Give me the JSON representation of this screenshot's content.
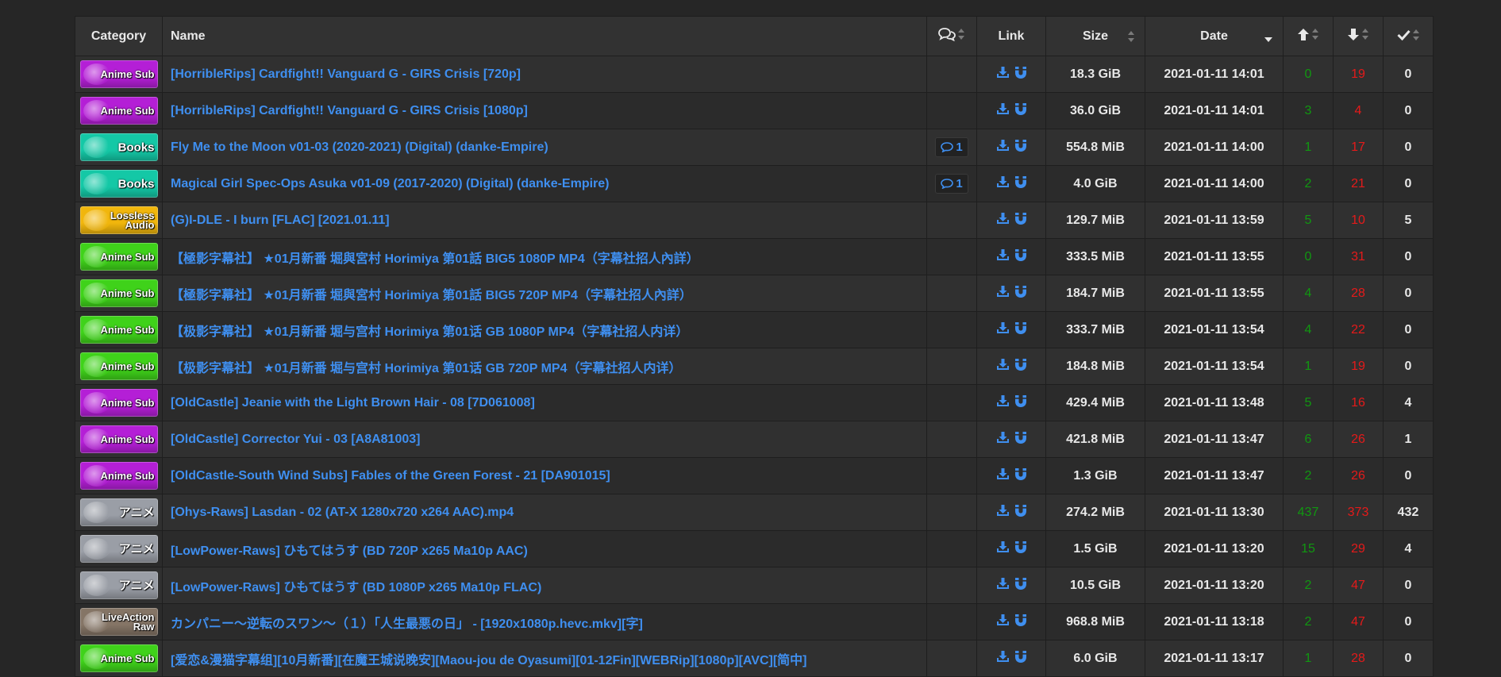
{
  "headers": {
    "category": "Category",
    "name": "Name",
    "comments_icon": "comments-icon",
    "link": "Link",
    "size": "Size",
    "date": "Date",
    "seeders_icon": "arrow-up-icon",
    "leechers_icon": "arrow-down-icon",
    "completed_icon": "check-icon"
  },
  "colors": {
    "link": "#3f8ff0",
    "seeders": "#109810",
    "leechers": "#e51a1a",
    "anime_sub_purple": "#b41fd6",
    "anime_sub_green": "#3fd21a",
    "books": "#14c8a6",
    "lossless_audio": "#f1b60c",
    "raw_anime": "#9a9ea6",
    "live_action_raw": "#857566"
  },
  "rows": [
    {
      "cat": "Anime Sub",
      "catColor": "#b41fd6",
      "name": "[HorribleRips] Cardfight!! Vanguard G - GIRS Crisis [720p]",
      "comments": "",
      "size": "18.3 GiB",
      "date": "2021-01-11 14:01",
      "seeders": "0",
      "leechers": "19",
      "completed": "0"
    },
    {
      "cat": "Anime Sub",
      "catColor": "#b41fd6",
      "name": "[HorribleRips] Cardfight!! Vanguard G - GIRS Crisis [1080p]",
      "comments": "",
      "size": "36.0 GiB",
      "date": "2021-01-11 14:01",
      "seeders": "3",
      "leechers": "4",
      "completed": "0"
    },
    {
      "cat": "Books",
      "catColor": "#14c8a6",
      "name": "Fly Me to the Moon v01-03 (2020-2021) (Digital) (danke-Empire)",
      "comments": "1",
      "size": "554.8 MiB",
      "date": "2021-01-11 14:00",
      "seeders": "1",
      "leechers": "17",
      "completed": "0"
    },
    {
      "cat": "Books",
      "catColor": "#14c8a6",
      "name": "Magical Girl Spec-Ops Asuka v01-09 (2017-2020) (Digital) (danke-Empire)",
      "comments": "1",
      "size": "4.0 GiB",
      "date": "2021-01-11 14:00",
      "seeders": "2",
      "leechers": "21",
      "completed": "0"
    },
    {
      "cat": "Lossless Audio",
      "catColor": "#f1b60c",
      "name": "(G)I-DLE - I burn [FLAC] [2021.01.11]",
      "comments": "",
      "size": "129.7 MiB",
      "date": "2021-01-11 13:59",
      "seeders": "5",
      "leechers": "10",
      "completed": "5"
    },
    {
      "cat": "Anime Sub",
      "catColor": "#3fd21a",
      "name": "【極影字幕社】 ★01月新番 堀與宮村 Horimiya 第01話 BIG5 1080P MP4（字幕社招人內詳）",
      "comments": "",
      "size": "333.5 MiB",
      "date": "2021-01-11 13:55",
      "seeders": "0",
      "leechers": "31",
      "completed": "0"
    },
    {
      "cat": "Anime Sub",
      "catColor": "#3fd21a",
      "name": "【極影字幕社】 ★01月新番 堀與宮村 Horimiya 第01話 BIG5 720P MP4（字幕社招人內詳）",
      "comments": "",
      "size": "184.7 MiB",
      "date": "2021-01-11 13:55",
      "seeders": "4",
      "leechers": "28",
      "completed": "0"
    },
    {
      "cat": "Anime Sub",
      "catColor": "#3fd21a",
      "name": "【极影字幕社】 ★01月新番 堀与宫村 Horimiya 第01话 GB 1080P MP4（字幕社招人内详）",
      "comments": "",
      "size": "333.7 MiB",
      "date": "2021-01-11 13:54",
      "seeders": "4",
      "leechers": "22",
      "completed": "0"
    },
    {
      "cat": "Anime Sub",
      "catColor": "#3fd21a",
      "name": "【极影字幕社】 ★01月新番 堀与宫村 Horimiya 第01话 GB 720P MP4（字幕社招人内详）",
      "comments": "",
      "size": "184.8 MiB",
      "date": "2021-01-11 13:54",
      "seeders": "1",
      "leechers": "19",
      "completed": "0"
    },
    {
      "cat": "Anime Sub",
      "catColor": "#b41fd6",
      "name": "[OldCastle] Jeanie with the Light Brown Hair - 08 [7D061008]",
      "comments": "",
      "size": "429.4 MiB",
      "date": "2021-01-11 13:48",
      "seeders": "5",
      "leechers": "16",
      "completed": "4"
    },
    {
      "cat": "Anime Sub",
      "catColor": "#b41fd6",
      "name": "[OldCastle] Corrector Yui - 03 [A8A81003]",
      "comments": "",
      "size": "421.8 MiB",
      "date": "2021-01-11 13:47",
      "seeders": "6",
      "leechers": "26",
      "completed": "1"
    },
    {
      "cat": "Anime Sub",
      "catColor": "#b41fd6",
      "name": "[OldCastle-South Wind Subs] Fables of the Green Forest - 21 [DA901015]",
      "comments": "",
      "size": "1.3 GiB",
      "date": "2021-01-11 13:47",
      "seeders": "2",
      "leechers": "26",
      "completed": "0"
    },
    {
      "cat": "アニメ",
      "catColor": "#9a9ea6",
      "name": "[Ohys-Raws] Lasdan - 02 (AT-X 1280x720 x264 AAC).mp4",
      "comments": "",
      "size": "274.2 MiB",
      "date": "2021-01-11 13:30",
      "seeders": "437",
      "leechers": "373",
      "completed": "432"
    },
    {
      "cat": "アニメ",
      "catColor": "#9a9ea6",
      "name": "[LowPower-Raws] ひもてはうす (BD 720P x265 Ma10p AAC)",
      "comments": "",
      "size": "1.5 GiB",
      "date": "2021-01-11 13:20",
      "seeders": "15",
      "leechers": "29",
      "completed": "4"
    },
    {
      "cat": "アニメ",
      "catColor": "#9a9ea6",
      "name": "[LowPower-Raws] ひもてはうす (BD 1080P x265 Ma10p FLAC)",
      "comments": "",
      "size": "10.5 GiB",
      "date": "2021-01-11 13:20",
      "seeders": "2",
      "leechers": "47",
      "completed": "0"
    },
    {
      "cat": "LiveAction Raw",
      "catColor": "#857566",
      "name": "カンパニー～逆転のスワン～（１）「人生最悪の日」 - [1920x1080p.hevc.mkv][字]",
      "comments": "",
      "size": "968.8 MiB",
      "date": "2021-01-11 13:18",
      "seeders": "2",
      "leechers": "47",
      "completed": "0"
    },
    {
      "cat": "Anime Sub",
      "catColor": "#3fd21a",
      "name": "[爱恋&漫猫字幕组][10月新番][在魔王城说晚安][Maou-jou de Oyasumi][01-12Fin][WEBRip][1080p][AVC][简中]",
      "comments": "",
      "size": "6.0 GiB",
      "date": "2021-01-11 13:17",
      "seeders": "1",
      "leechers": "28",
      "completed": "0"
    }
  ]
}
